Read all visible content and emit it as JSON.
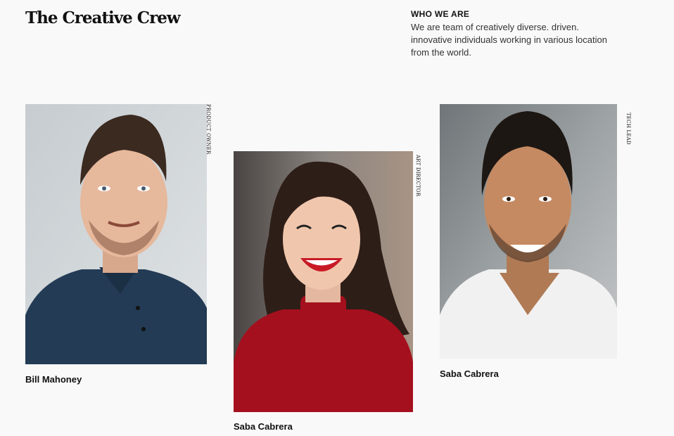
{
  "header": {
    "title": "The Creative Crew"
  },
  "about": {
    "heading": "WHO WE ARE",
    "text": "We are team of creatively diverse. driven. innovative individuals working in various location from the world."
  },
  "team": [
    {
      "name": "Bill Mahoney",
      "role": "PRODUCT OWNER"
    },
    {
      "name": "Saba Cabrera",
      "role": "ART DIRECTOR"
    },
    {
      "name": "Saba Cabrera",
      "role": "TECH LEAD"
    }
  ]
}
